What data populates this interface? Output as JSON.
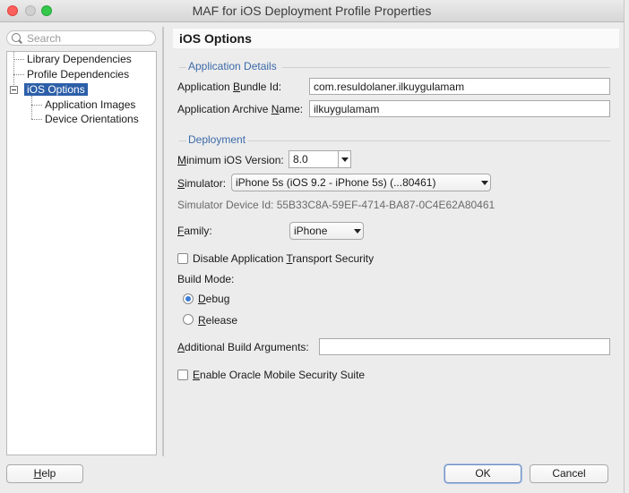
{
  "window": {
    "title": "MAF for iOS Deployment Profile Properties"
  },
  "search": {
    "placeholder": "Search"
  },
  "tree": {
    "items": [
      {
        "label": "Library Dependencies"
      },
      {
        "label": "Profile Dependencies"
      },
      {
        "label": "iOS Options",
        "selected": true
      },
      {
        "label": "Application Images"
      },
      {
        "label": "Device Orientations"
      }
    ]
  },
  "panel": {
    "title": "iOS Options",
    "app_details": {
      "heading": "Application Details",
      "bundle_id_label_pre": "Application ",
      "bundle_id_label_mn": "B",
      "bundle_id_label_post": "undle Id:",
      "bundle_id_value": "com.resuldolaner.ilkuygulamam",
      "archive_label_pre": "Application Archive ",
      "archive_label_mn": "N",
      "archive_label_post": "ame:",
      "archive_value": "ilkuygulamam"
    },
    "deployment": {
      "heading": "Deployment",
      "min_ios_label_mn": "M",
      "min_ios_label_post": "inimum iOS Version:",
      "min_ios_value": "8.0",
      "simulator_label_mn": "S",
      "simulator_label_post": "imulator:",
      "simulator_value": "iPhone 5s (iOS 9.2 - iPhone 5s) (...80461)",
      "simulator_device_id": "Simulator Device Id: 55B33C8A-59EF-4714-BA87-0C4E62A80461",
      "family_label_mn": "F",
      "family_label_post": "amily:",
      "family_value": "iPhone",
      "ats_label_pre": "Disable Application ",
      "ats_label_mn": "T",
      "ats_label_post": "ransport Security",
      "ats_checked": false,
      "build_mode_label": "Build Mode:",
      "debug_mn": "D",
      "debug_post": "ebug",
      "release_mn": "R",
      "release_post": "elease",
      "build_mode_selected": "Debug",
      "additional_args_label_mn": "A",
      "additional_args_label_post": "dditional Build Arguments:",
      "additional_args_value": "",
      "omss_label_mn": "E",
      "omss_label_post": "nable Oracle Mobile Security Suite",
      "omss_checked": false
    }
  },
  "footer": {
    "help_mn": "H",
    "help_post": "elp",
    "ok_label": "OK",
    "cancel_label": "Cancel"
  },
  "colors": {
    "selection": "#2c5fa8",
    "section_heading": "#3c6aa8"
  }
}
